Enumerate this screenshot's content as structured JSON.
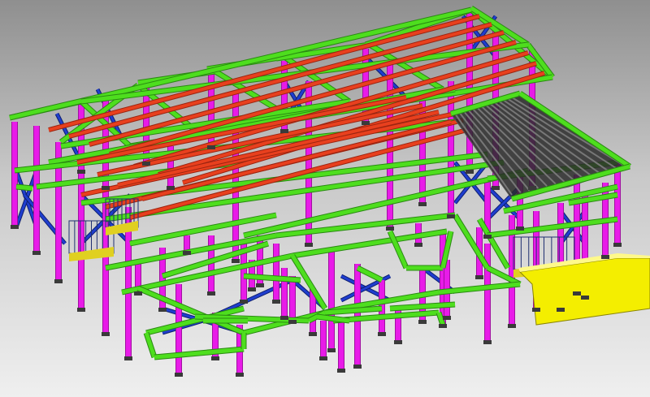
{
  "scene": {
    "view": "3d-structural-steel-model",
    "background": {
      "top": "#8f8f8f",
      "mid": "#c9c9c9",
      "bottom": "#efefef"
    },
    "colors": {
      "column": "#e81be8",
      "column_dark": "#a010a0",
      "beam": "#4ede1e",
      "beam_dark": "#2a8a12",
      "purlin": "#e8401e",
      "purlin_dark": "#9c2410",
      "bracing": "#1f3ecf",
      "roof_sheet": "#2a2a2a",
      "roof_sheet_edge": "#555555",
      "stair": "#e0d020",
      "base_plate": "#3a3a3a",
      "stair_handrail": "#203070",
      "concrete_block": "#f4ee00"
    },
    "components": [
      "main-frame",
      "roof-purlins",
      "canopy-roof",
      "stair-left",
      "stair-right",
      "platform-front",
      "concrete-block"
    ]
  }
}
